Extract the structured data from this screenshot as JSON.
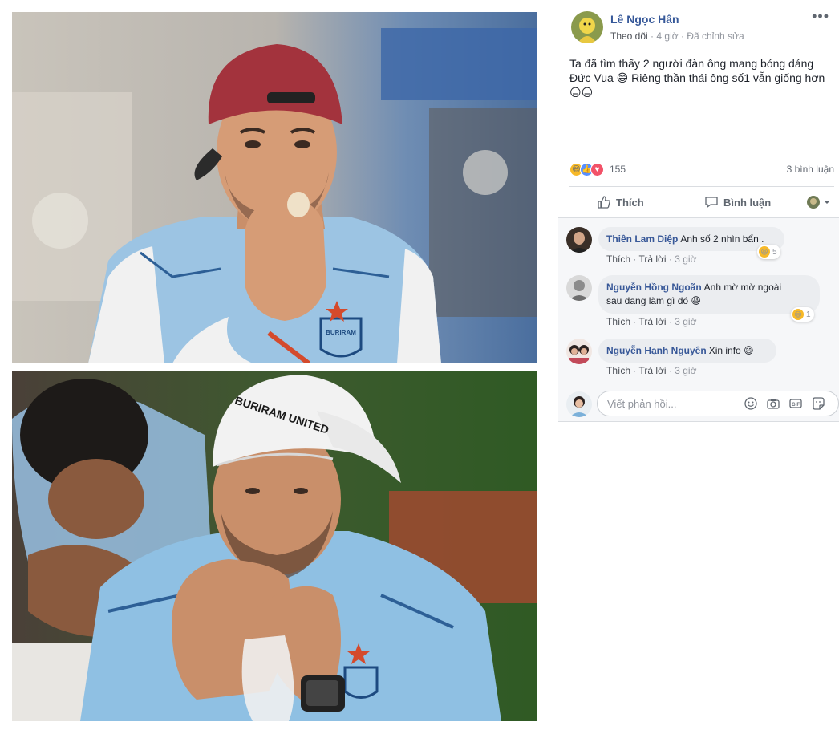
{
  "post": {
    "author": "Lê Ngọc Hân",
    "follow": "Theo dõi",
    "time": "4 giờ",
    "edited": "Đã chỉnh sửa",
    "more": "•••",
    "text_line1": "Ta đã tìm thấy 2 người đàn ông mang bóng dáng",
    "text_line2_a": "Đức Vua",
    "text_line2_b": "Riêng thần thái ông số1 vẫn giống hơn",
    "reactions_count": "155",
    "comment_count": "3 bình luận",
    "like_label": "Thích",
    "comment_label": "Bình luận"
  },
  "photos": {
    "top_cap_text": "BURIRAM",
    "bottom_cap_text": "BURIRAM UNITED"
  },
  "comments": [
    {
      "name": "Thiên Lam Diệp",
      "text": "Anh số 2 nhìn bẩn .",
      "like": "Thích",
      "reply": "Trả lời",
      "time": "3 giờ",
      "reactions": "5"
    },
    {
      "name": "Nguyễn Hồng Ngoãn",
      "text_line1": "Anh mờ mờ ngoài",
      "text_line2": "sau đang làm gì đó",
      "like": "Thích",
      "reply": "Trả lời",
      "time": "3 giờ",
      "reactions": "1"
    },
    {
      "name": "Nguyễn Hạnh Nguyên",
      "text": "Xin info",
      "like": "Thích",
      "reply": "Trả lời",
      "time": "3 giờ"
    }
  ],
  "reply": {
    "placeholder": "Viết phản hồi..."
  },
  "colors": {
    "link": "#365899",
    "meta": "#90949c",
    "bubble": "#ebedf0",
    "haha": "#f7b928",
    "like": "#5890ff",
    "love": "#f25268"
  },
  "icons": [
    "more-icon",
    "haha-reaction-icon",
    "like-reaction-icon",
    "love-reaction-icon",
    "thumbs-up-icon",
    "comment-bubble-icon",
    "share-avatar-icon",
    "emoji-icon",
    "camera-icon",
    "gif-icon",
    "sticker-icon"
  ]
}
